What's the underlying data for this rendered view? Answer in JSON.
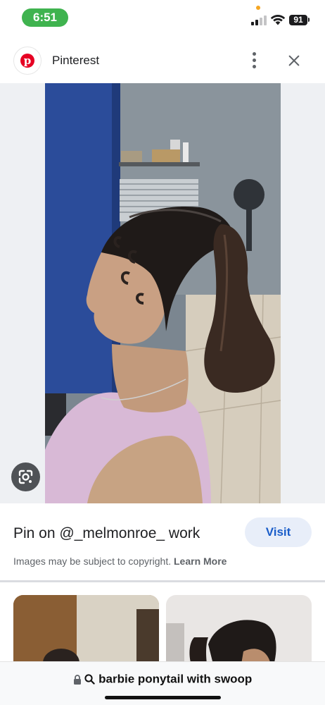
{
  "status_bar": {
    "time": "6:51",
    "battery": "91"
  },
  "header": {
    "site_name": "Pinterest",
    "logo_letter": "p"
  },
  "result": {
    "title": "Pin on @_melmonroe_ work",
    "visit_label": "Visit",
    "copyright_text": "Images may be subject to copyright.",
    "learn_more": "Learn More"
  },
  "search": {
    "query": "barbie ponytail with swoop"
  },
  "icons": {
    "pinterest": "pinterest-logo-icon",
    "more": "more-vert-icon",
    "close": "close-icon",
    "lens": "lens-icon",
    "lock": "lock-icon",
    "search": "search-icon"
  },
  "colors": {
    "status_time_bg": "#3fb34f",
    "pinterest_red": "#e60023",
    "visit_bg": "#e8eef9",
    "visit_text": "#1a5dc9"
  }
}
